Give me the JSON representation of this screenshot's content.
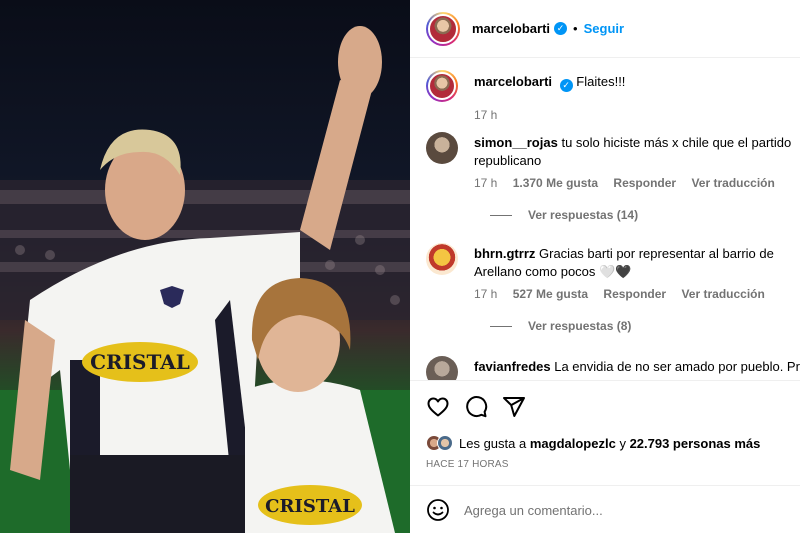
{
  "post": {
    "author": "marcelobarti",
    "follow_label": "Seguir",
    "separator": "•",
    "caption": "Flaites!!!",
    "caption_time": "17 h"
  },
  "photo": {
    "shirt_text": "CRISTAL"
  },
  "comments": [
    {
      "user": "simon__rojas",
      "text": "tu solo hiciste más x chile que el partido republicano",
      "time": "17 h",
      "likes": "1.370 Me gusta",
      "reply": "Responder",
      "translate": "Ver traducción",
      "view_replies": "Ver respuestas (14)"
    },
    {
      "user": "bhrn.gtrrz",
      "text": "Gracias barti por representar al barrio de Arellano como pocos 🤍🖤",
      "time": "17 h",
      "likes": "527 Me gusta",
      "reply": "Responder",
      "translate": "Ver traducción",
      "view_replies": "Ver respuestas (8)"
    },
    {
      "user": "favianfredes",
      "text": "La envidia de no ser amado por pueblo. Pri..."
    }
  ],
  "actions": {
    "likes_prefix": "Les gusta a",
    "likes_user": "magdalopezlc",
    "likes_middle": "y",
    "likes_count": "22.793 personas más",
    "posted_ago": "HACE 17 HORAS",
    "comment_placeholder": "Agrega un comentario..."
  }
}
